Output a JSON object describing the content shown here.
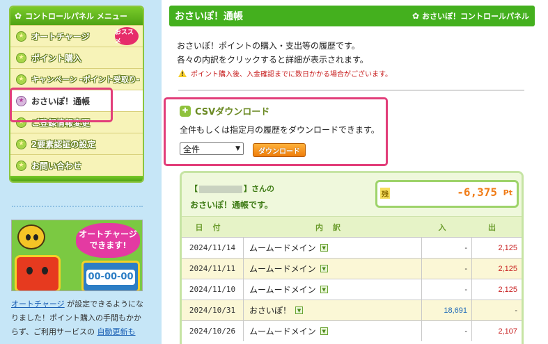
{
  "sidebar": {
    "title": "コントロールパネル メニュー",
    "items": [
      {
        "label": "オートチャージ",
        "badge": "おススメ"
      },
      {
        "label": "ポイント購入"
      },
      {
        "label": "キャンペーン -ポイント受取り-"
      },
      {
        "label": "おさいぽ！通帳",
        "current": true
      },
      {
        "label": "ご登録情報変更"
      },
      {
        "label": "2要素認証の設定"
      },
      {
        "label": "お問い合わせ"
      }
    ]
  },
  "banner": {
    "line1": "オートチャージ",
    "line2": "できます!",
    "screen": "00-00-00"
  },
  "side_note": {
    "link1": "オートチャージ",
    "text1": " が設定できるようになりました！ポイント購入の手間もかからず、ご利用サービスの ",
    "link2": "自動更新も"
  },
  "header": {
    "title": "おさいぽ！通帳",
    "subtitle": "おさいぽ！コントロールパネル"
  },
  "intro": {
    "line1": "おさいぽ！ポイントの購入・支出等の履歴です。",
    "line2": "各々の内訳をクリックすると詳細が表示されます。",
    "warning": "ポイント購入後、入金確認までに数日かかる場合がございます。"
  },
  "csv": {
    "title": "CSVダウンロード",
    "description": "全件もしくは指定月の履歴をダウンロードできます。",
    "select_value": "全件",
    "button": "ダウンロード"
  },
  "history": {
    "user_suffix": "】さんの",
    "user_prefix": "【",
    "name_line": "おさいぽ！通帳です。",
    "balance_label": "残",
    "balance": "-6,375",
    "balance_unit": "Pt",
    "columns": [
      "日付",
      "内訳",
      "入",
      "出"
    ],
    "rows": [
      {
        "date": "2024/11/14",
        "detail": "ムームードメイン",
        "in": "-",
        "out": "2,125"
      },
      {
        "date": "2024/11/11",
        "detail": "ムームードメイン",
        "in": "-",
        "out": "2,125"
      },
      {
        "date": "2024/11/10",
        "detail": "ムームードメイン",
        "in": "-",
        "out": "2,125"
      },
      {
        "date": "2024/10/31",
        "detail": "おさいぽ！",
        "in": "18,691",
        "out": "-"
      },
      {
        "date": "2024/10/26",
        "detail": "ムームードメイン",
        "in": "-",
        "out": "2,107"
      }
    ]
  },
  "colors": {
    "accent_green": "#44b01e",
    "highlight": "#e23e7a",
    "out_red": "#c82020",
    "in_blue": "#1a66b8",
    "balance_orange": "#f07c18"
  }
}
